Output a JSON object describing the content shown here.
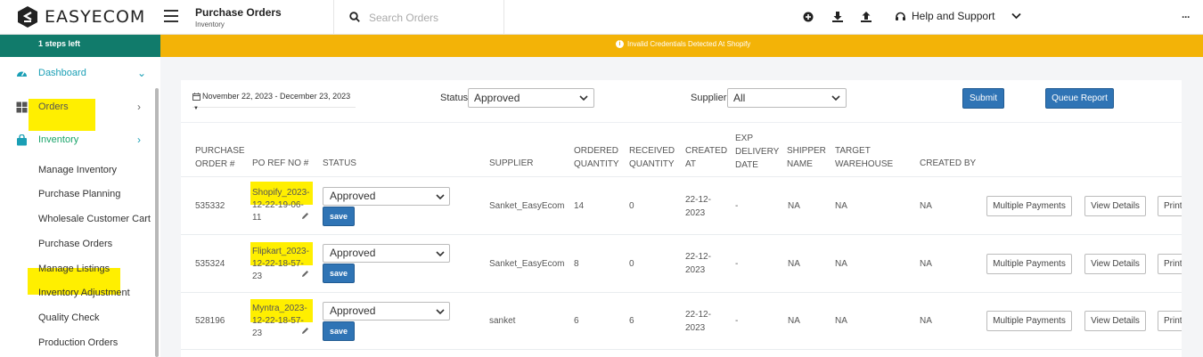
{
  "app": {
    "logo_text": "EASYECOM",
    "page_title": "Purchase Orders",
    "page_subtitle": "Inventory",
    "search_placeholder": "Search Orders",
    "help_label": "Help and Support"
  },
  "sidebar": {
    "steps_left": "1 steps left",
    "nav": [
      {
        "label": "Dashboard"
      },
      {
        "label": "Orders"
      },
      {
        "label": "Inventory"
      }
    ],
    "sub_items": [
      "Manage Inventory",
      "Purchase Planning",
      "Wholesale Customer Cart",
      "Purchase Orders",
      "Manage Listings",
      "Inventory Adjustment",
      "Quality Check",
      "Production Orders"
    ]
  },
  "banner": {
    "text": "Invalid Credentials Detected At Shopify"
  },
  "filters": {
    "date_range": "November 22, 2023 - December 23, 2023",
    "status_label": "Status",
    "status_value": "Approved",
    "supplier_label": "Supplier",
    "supplier_value": "All",
    "submit_label": "Submit",
    "queue_label": "Queue Report"
  },
  "table": {
    "headers": {
      "po_number": [
        "PURCHASE",
        "ORDER #"
      ],
      "po_ref": "PO REF NO #",
      "status": "STATUS",
      "supplier": "SUPPLIER",
      "ordered_qty": [
        "ORDERED",
        "QUANTITY"
      ],
      "received_qty": [
        "RECEIVED",
        "QUANTITY"
      ],
      "created_at": [
        "CREATED",
        "AT"
      ],
      "exp_delivery": [
        "EXP",
        "DELIVERY",
        "DATE"
      ],
      "shipper": [
        "SHIPPER",
        "NAME"
      ],
      "target_wh": [
        "TARGET",
        "WAREHOUSE"
      ],
      "created_by": "CREATED BY"
    },
    "rows": [
      {
        "po_number": "535332",
        "po_ref_lines": [
          "Shopify_2023-",
          "12-22-19-06-",
          "11"
        ],
        "status": "Approved",
        "save": "save",
        "supplier": "Sanket_EasyEcom",
        "ordered": "14",
        "received": "0",
        "created_lines": [
          "22-12-",
          "2023"
        ],
        "exp_delivery": "-",
        "shipper": "NA",
        "target_wh": "NA",
        "created_by": "NA",
        "btn_payments": "Multiple Payments",
        "btn_details": "View Details",
        "btn_print": "Print"
      },
      {
        "po_number": "535324",
        "po_ref_lines": [
          "Flipkart_2023-",
          "12-22-18-57-",
          "23"
        ],
        "status": "Approved",
        "save": "save",
        "supplier": "Sanket_EasyEcom",
        "ordered": "8",
        "received": "0",
        "created_lines": [
          "22-12-",
          "2023"
        ],
        "exp_delivery": "-",
        "shipper": "NA",
        "target_wh": "NA",
        "created_by": "NA",
        "btn_payments": "Multiple Payments",
        "btn_details": "View Details",
        "btn_print": "Print"
      },
      {
        "po_number": "528196",
        "po_ref_lines": [
          "Myntra_2023-",
          "12-22-18-57-",
          "23"
        ],
        "status": "Approved",
        "save": "save",
        "supplier": "sanket",
        "ordered": "6",
        "received": "6",
        "created_lines": [
          "22-12-",
          "2023"
        ],
        "exp_delivery": "-",
        "shipper": "NA",
        "target_wh": "NA",
        "created_by": "NA",
        "btn_payments": "Multiple Payments",
        "btn_details": "View Details",
        "btn_print": "Print"
      }
    ]
  },
  "colors": {
    "steps_bar": "#117b6b",
    "banner": "#f3b307",
    "primary_button": "#2f74b5",
    "highlight": "#ffef00",
    "nav_active": "#1a9fb5"
  },
  "icons": {
    "logo": "easyecom-logo-icon",
    "menu": "hamburger-menu-icon",
    "search": "search-icon",
    "add": "plus-circle-icon",
    "download": "download-icon",
    "upload": "upload-icon",
    "support": "headset-icon",
    "more": "more-dots-icon"
  }
}
